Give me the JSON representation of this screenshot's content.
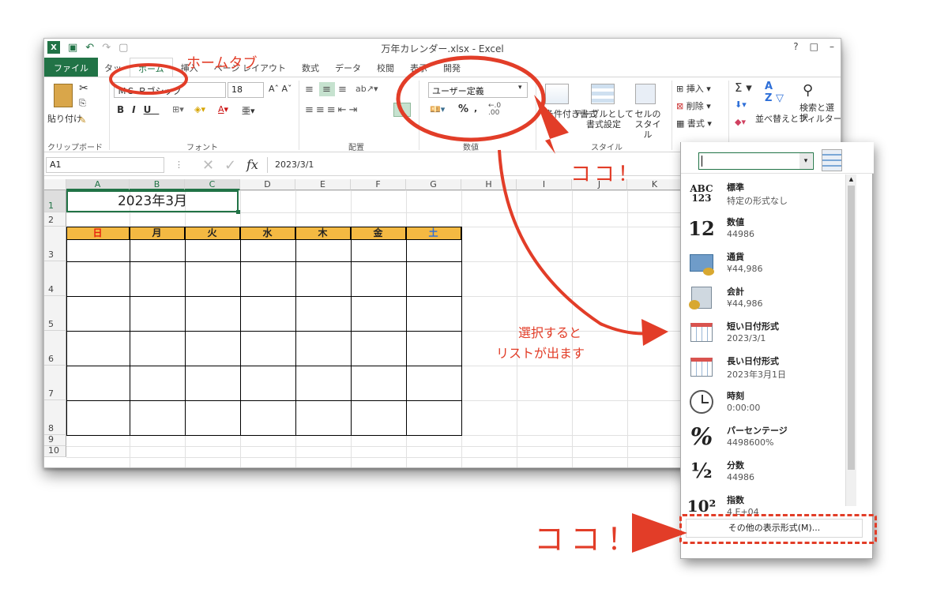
{
  "window": {
    "title": "万年カレンダー.xlsx - Excel",
    "controls": [
      "?",
      "□",
      "–"
    ]
  },
  "tabs": [
    "ファイル",
    "ホーム",
    "挿入",
    "ページ レイアウト",
    "数式",
    "データ",
    "校閲",
    "表示",
    "開発"
  ],
  "ribbon": {
    "clipboard": {
      "paste": "貼り付け",
      "label": "クリップボード"
    },
    "font": {
      "name": "ＭＳ Ｐゴシック",
      "size": "18",
      "label": "フォント"
    },
    "alignment": {
      "label": "配置"
    },
    "number": {
      "format": "ユーザー定義",
      "label": "数値"
    },
    "styles": {
      "cond": "条件付き書式",
      "table": "テーブルとして書式設定",
      "cell": "セルのスタイル",
      "label": "スタイル"
    },
    "cells": {
      "insert": "挿入",
      "delete": "削除",
      "format": "書式"
    },
    "editing": {
      "sort": "並べ替えとフィルター",
      "find": "検索と選択"
    }
  },
  "formula_bar": {
    "cell_ref": "A1",
    "fx": "fx",
    "value": "2023/3/1"
  },
  "columns": [
    "A",
    "B",
    "C",
    "D",
    "E",
    "F",
    "G",
    "H",
    "I",
    "J",
    "K"
  ],
  "rows": [
    "1",
    "2",
    "3",
    "4",
    "5",
    "6",
    "7",
    "8",
    "9",
    "10"
  ],
  "calendar": {
    "title": "2023年3月",
    "weekdays": [
      "日",
      "月",
      "火",
      "水",
      "木",
      "金",
      "土"
    ],
    "colors": {
      "sunday": "#e8210e",
      "saturday": "#2e6fd8",
      "header_bg": "#f4b942"
    }
  },
  "dropdown": {
    "items": [
      {
        "icon": "ABC\n123",
        "name": "標準",
        "sample": "特定の形式なし"
      },
      {
        "icon": "12",
        "name": "数値",
        "sample": "44986"
      },
      {
        "icon": "currency-icon",
        "name": "通貨",
        "sample": "¥44,986"
      },
      {
        "icon": "accounting-icon",
        "name": "会計",
        "sample": "¥44,986"
      },
      {
        "icon": "calendar-icon",
        "name": "短い日付形式",
        "sample": "2023/3/1"
      },
      {
        "icon": "calendar-icon",
        "name": "長い日付形式",
        "sample": "2023年3月1日"
      },
      {
        "icon": "clock-icon",
        "name": "時刻",
        "sample": "0:00:00"
      },
      {
        "icon": "%",
        "name": "パーセンテージ",
        "sample": "4498600%"
      },
      {
        "icon": "½",
        "name": "分数",
        "sample": "44986"
      },
      {
        "icon": "10²",
        "name": "指数",
        "sample": "4.E+04"
      }
    ],
    "more": "その他の表示形式(M)..."
  },
  "annotations": {
    "home_tab": "ホームタブ",
    "here1": "ココ！",
    "here2": "ココ！",
    "list_line1": "選択すると",
    "list_line2": "リストが出ます"
  }
}
